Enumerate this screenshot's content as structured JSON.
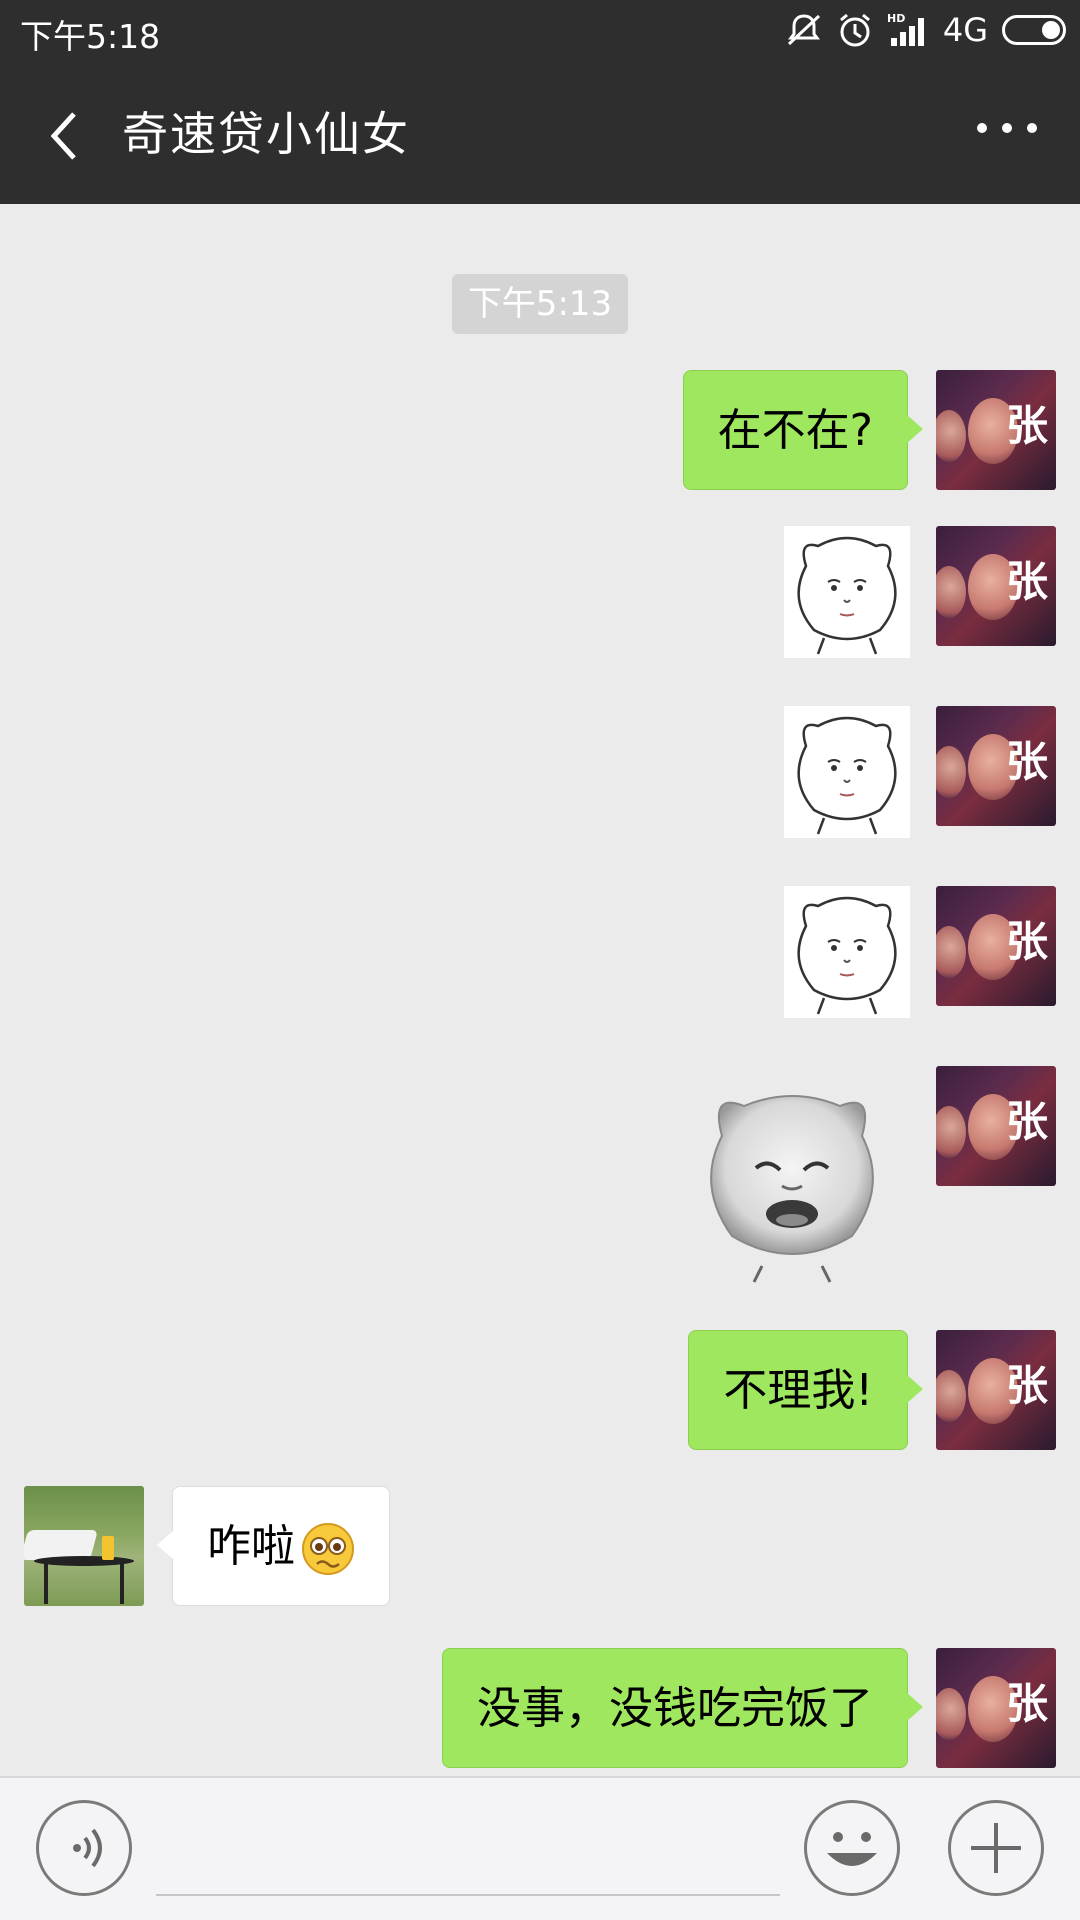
{
  "status_bar": {
    "time": "下午5:18",
    "network": "4G",
    "icons": [
      "mute-vibrate-icon",
      "alarm-icon",
      "hd-signal-icon",
      "battery-icon"
    ]
  },
  "header": {
    "title": "奇速贷小仙女",
    "back_icon": "chevron-left-icon",
    "more_icon": "more-dots-icon"
  },
  "chat": {
    "timestamp": "下午5:13",
    "messages": [
      {
        "sender": "me",
        "type": "text",
        "text": "在不在?"
      },
      {
        "sender": "me",
        "type": "sticker",
        "sticker": "bear-face-blank-sticker"
      },
      {
        "sender": "me",
        "type": "sticker",
        "sticker": "bear-face-blank-sticker"
      },
      {
        "sender": "me",
        "type": "sticker",
        "sticker": "bear-face-blank-sticker"
      },
      {
        "sender": "me",
        "type": "sticker",
        "sticker": "bear-crying-sticker"
      },
      {
        "sender": "me",
        "type": "text",
        "text": "不理我!"
      },
      {
        "sender": "them",
        "type": "text",
        "text": "咋啦",
        "emoji": "pleading-face-emoji"
      },
      {
        "sender": "me",
        "type": "text",
        "text": "没事，没钱吃完饭了"
      }
    ],
    "my_avatar_text": "张"
  },
  "input_bar": {
    "voice_icon": "voice-icon",
    "emoji_icon": "emoji-icon",
    "plus_icon": "plus-icon",
    "input_value": ""
  },
  "colors": {
    "header_bg": "#2e2e2e",
    "chat_bg": "#ebebeb",
    "my_bubble": "#9fe75f",
    "their_bubble": "#ffffff",
    "timestamp_bg": "#d4d4d4"
  }
}
